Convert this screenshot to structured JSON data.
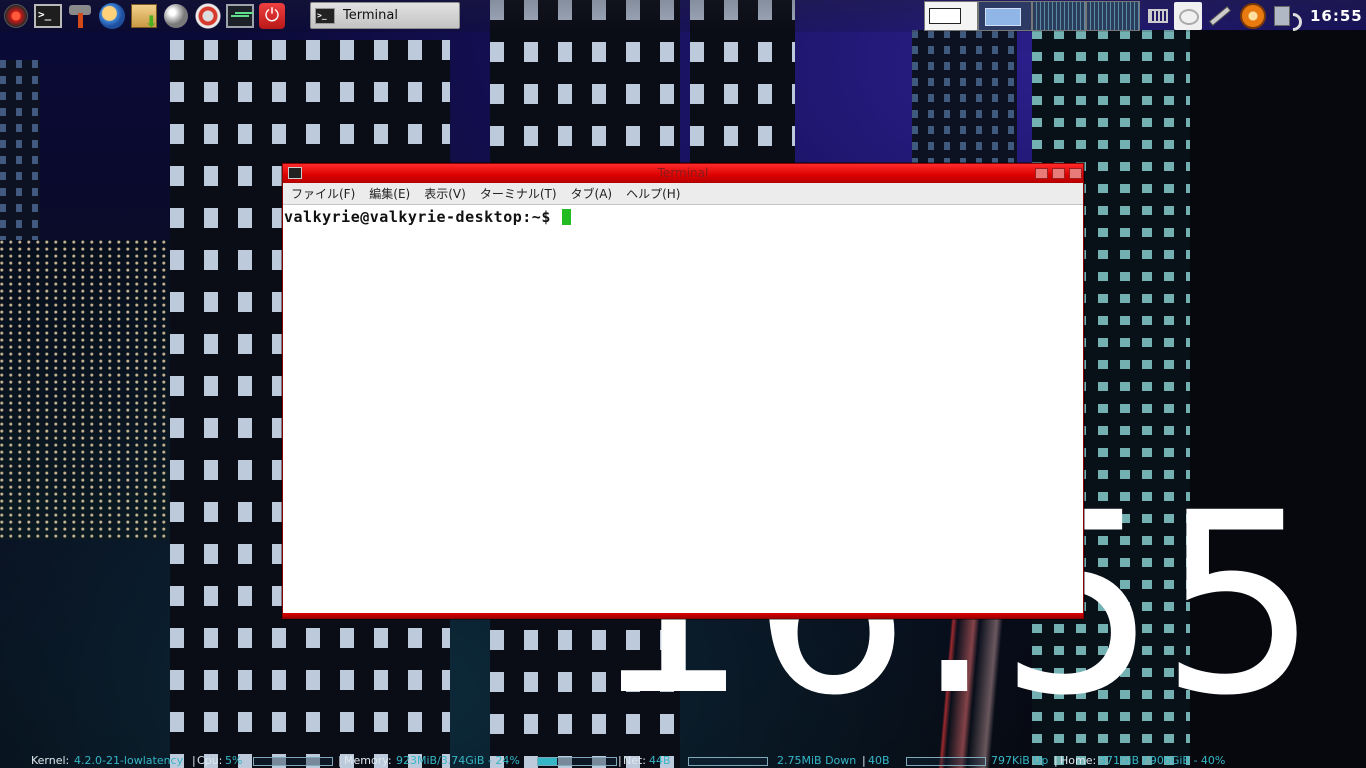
{
  "panel": {
    "launchers": [
      {
        "name": "menu-icon"
      },
      {
        "name": "terminal-icon"
      },
      {
        "name": "tools-icon"
      },
      {
        "name": "browser-icon"
      },
      {
        "name": "archive-icon"
      },
      {
        "name": "disc-icon"
      },
      {
        "name": "settings-icon"
      },
      {
        "name": "system-monitor-icon"
      },
      {
        "name": "power-icon"
      }
    ],
    "taskbar_item": "Terminal",
    "clock": "16:55"
  },
  "desktop": {
    "big_clock": "16:55"
  },
  "terminal": {
    "title": "Terminal",
    "menu": [
      "ファイル(F)",
      "編集(E)",
      "表示(V)",
      "ターミナル(T)",
      "タブ(A)",
      "ヘルプ(H)"
    ],
    "prompt": "valkyrie@valkyrie-desktop:~$ "
  },
  "status_bar": {
    "kernel_label": "Kernel:",
    "kernel_value": "4.2.0-21-lowlatency",
    "cpu_label": "Cpu:",
    "cpu_value": "5%",
    "memory_label": "Memory:",
    "memory_value": "923MiB/3.74GiB - 24%",
    "memory_percent": 24,
    "net_label": "Net:",
    "net_value": "44B",
    "down_value": "2.75MiB Down",
    "down_rate": "40B",
    "up_value": "797KiB Up",
    "home_label": "Home:",
    "home_value": "371GiB / 906GiB - 40%"
  },
  "colors": {
    "accent": "#dc0000",
    "status_value": "#35b6c6",
    "cursor": "#22bb22"
  }
}
